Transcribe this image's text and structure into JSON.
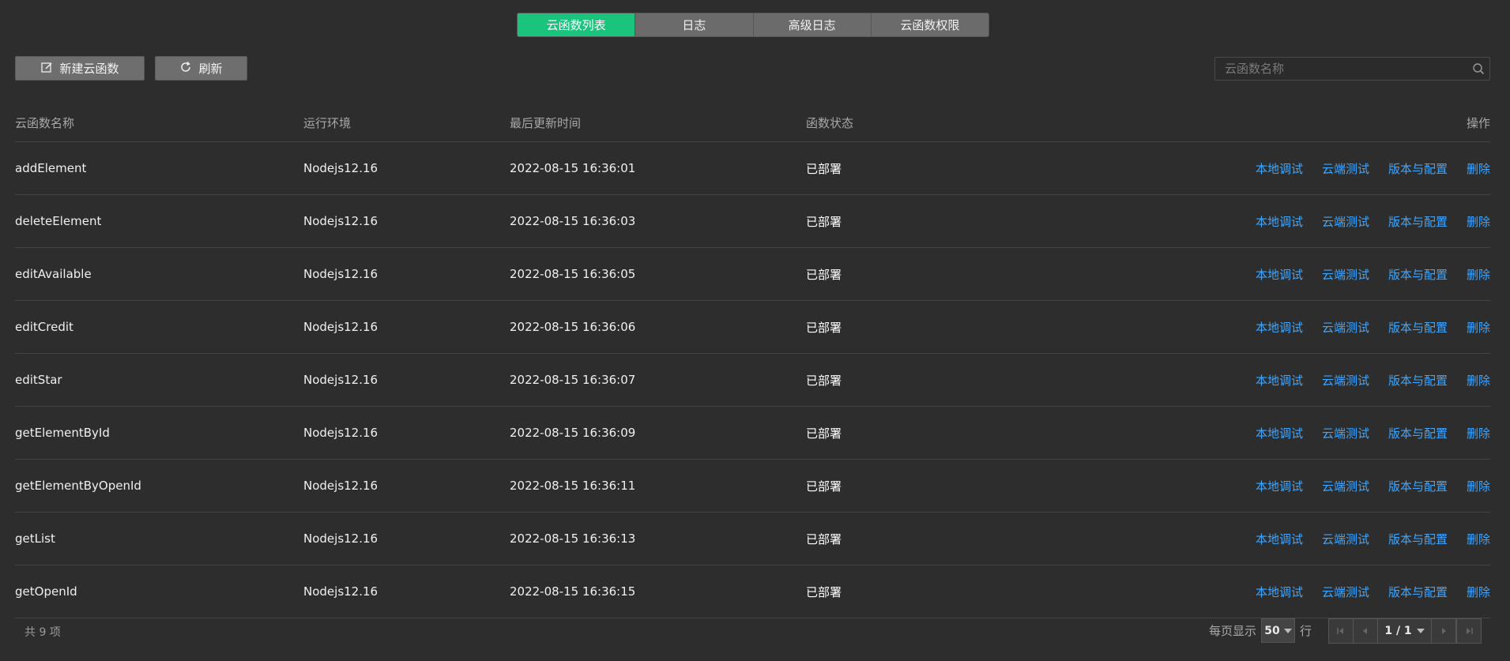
{
  "tabs": [
    {
      "label": "云函数列表",
      "active": true
    },
    {
      "label": "日志",
      "active": false
    },
    {
      "label": "高级日志",
      "active": false
    },
    {
      "label": "云函数权限",
      "active": false
    }
  ],
  "toolbar": {
    "new_label": "新建云函数",
    "refresh_label": "刷新",
    "search_placeholder": "云函数名称"
  },
  "table": {
    "headers": {
      "name": "云函数名称",
      "env": "运行环境",
      "time": "最后更新时间",
      "status": "函数状态",
      "ops": "操作"
    },
    "ops_labels": [
      "本地调试",
      "云端测试",
      "版本与配置",
      "删除"
    ],
    "rows": [
      {
        "name": "addElement",
        "env": "Nodejs12.16",
        "time": "2022-08-15 16:36:01",
        "status": "已部署"
      },
      {
        "name": "deleteElement",
        "env": "Nodejs12.16",
        "time": "2022-08-15 16:36:03",
        "status": "已部署"
      },
      {
        "name": "editAvailable",
        "env": "Nodejs12.16",
        "time": "2022-08-15 16:36:05",
        "status": "已部署"
      },
      {
        "name": "editCredit",
        "env": "Nodejs12.16",
        "time": "2022-08-15 16:36:06",
        "status": "已部署"
      },
      {
        "name": "editStar",
        "env": "Nodejs12.16",
        "time": "2022-08-15 16:36:07",
        "status": "已部署"
      },
      {
        "name": "getElementById",
        "env": "Nodejs12.16",
        "time": "2022-08-15 16:36:09",
        "status": "已部署"
      },
      {
        "name": "getElementByOpenId",
        "env": "Nodejs12.16",
        "time": "2022-08-15 16:36:11",
        "status": "已部署"
      },
      {
        "name": "getList",
        "env": "Nodejs12.16",
        "time": "2022-08-15 16:36:13",
        "status": "已部署"
      },
      {
        "name": "getOpenId",
        "env": "Nodejs12.16",
        "time": "2022-08-15 16:36:15",
        "status": "已部署"
      }
    ]
  },
  "footer": {
    "total": "共 9 项",
    "per_page_label": "每页显示",
    "per_page_value": "50",
    "per_page_unit": "行",
    "page_indicator": "1 / 1"
  },
  "colors": {
    "active_tab": "#1bc47d",
    "link": "#3ea6ff",
    "background": "#2d2d2d"
  }
}
